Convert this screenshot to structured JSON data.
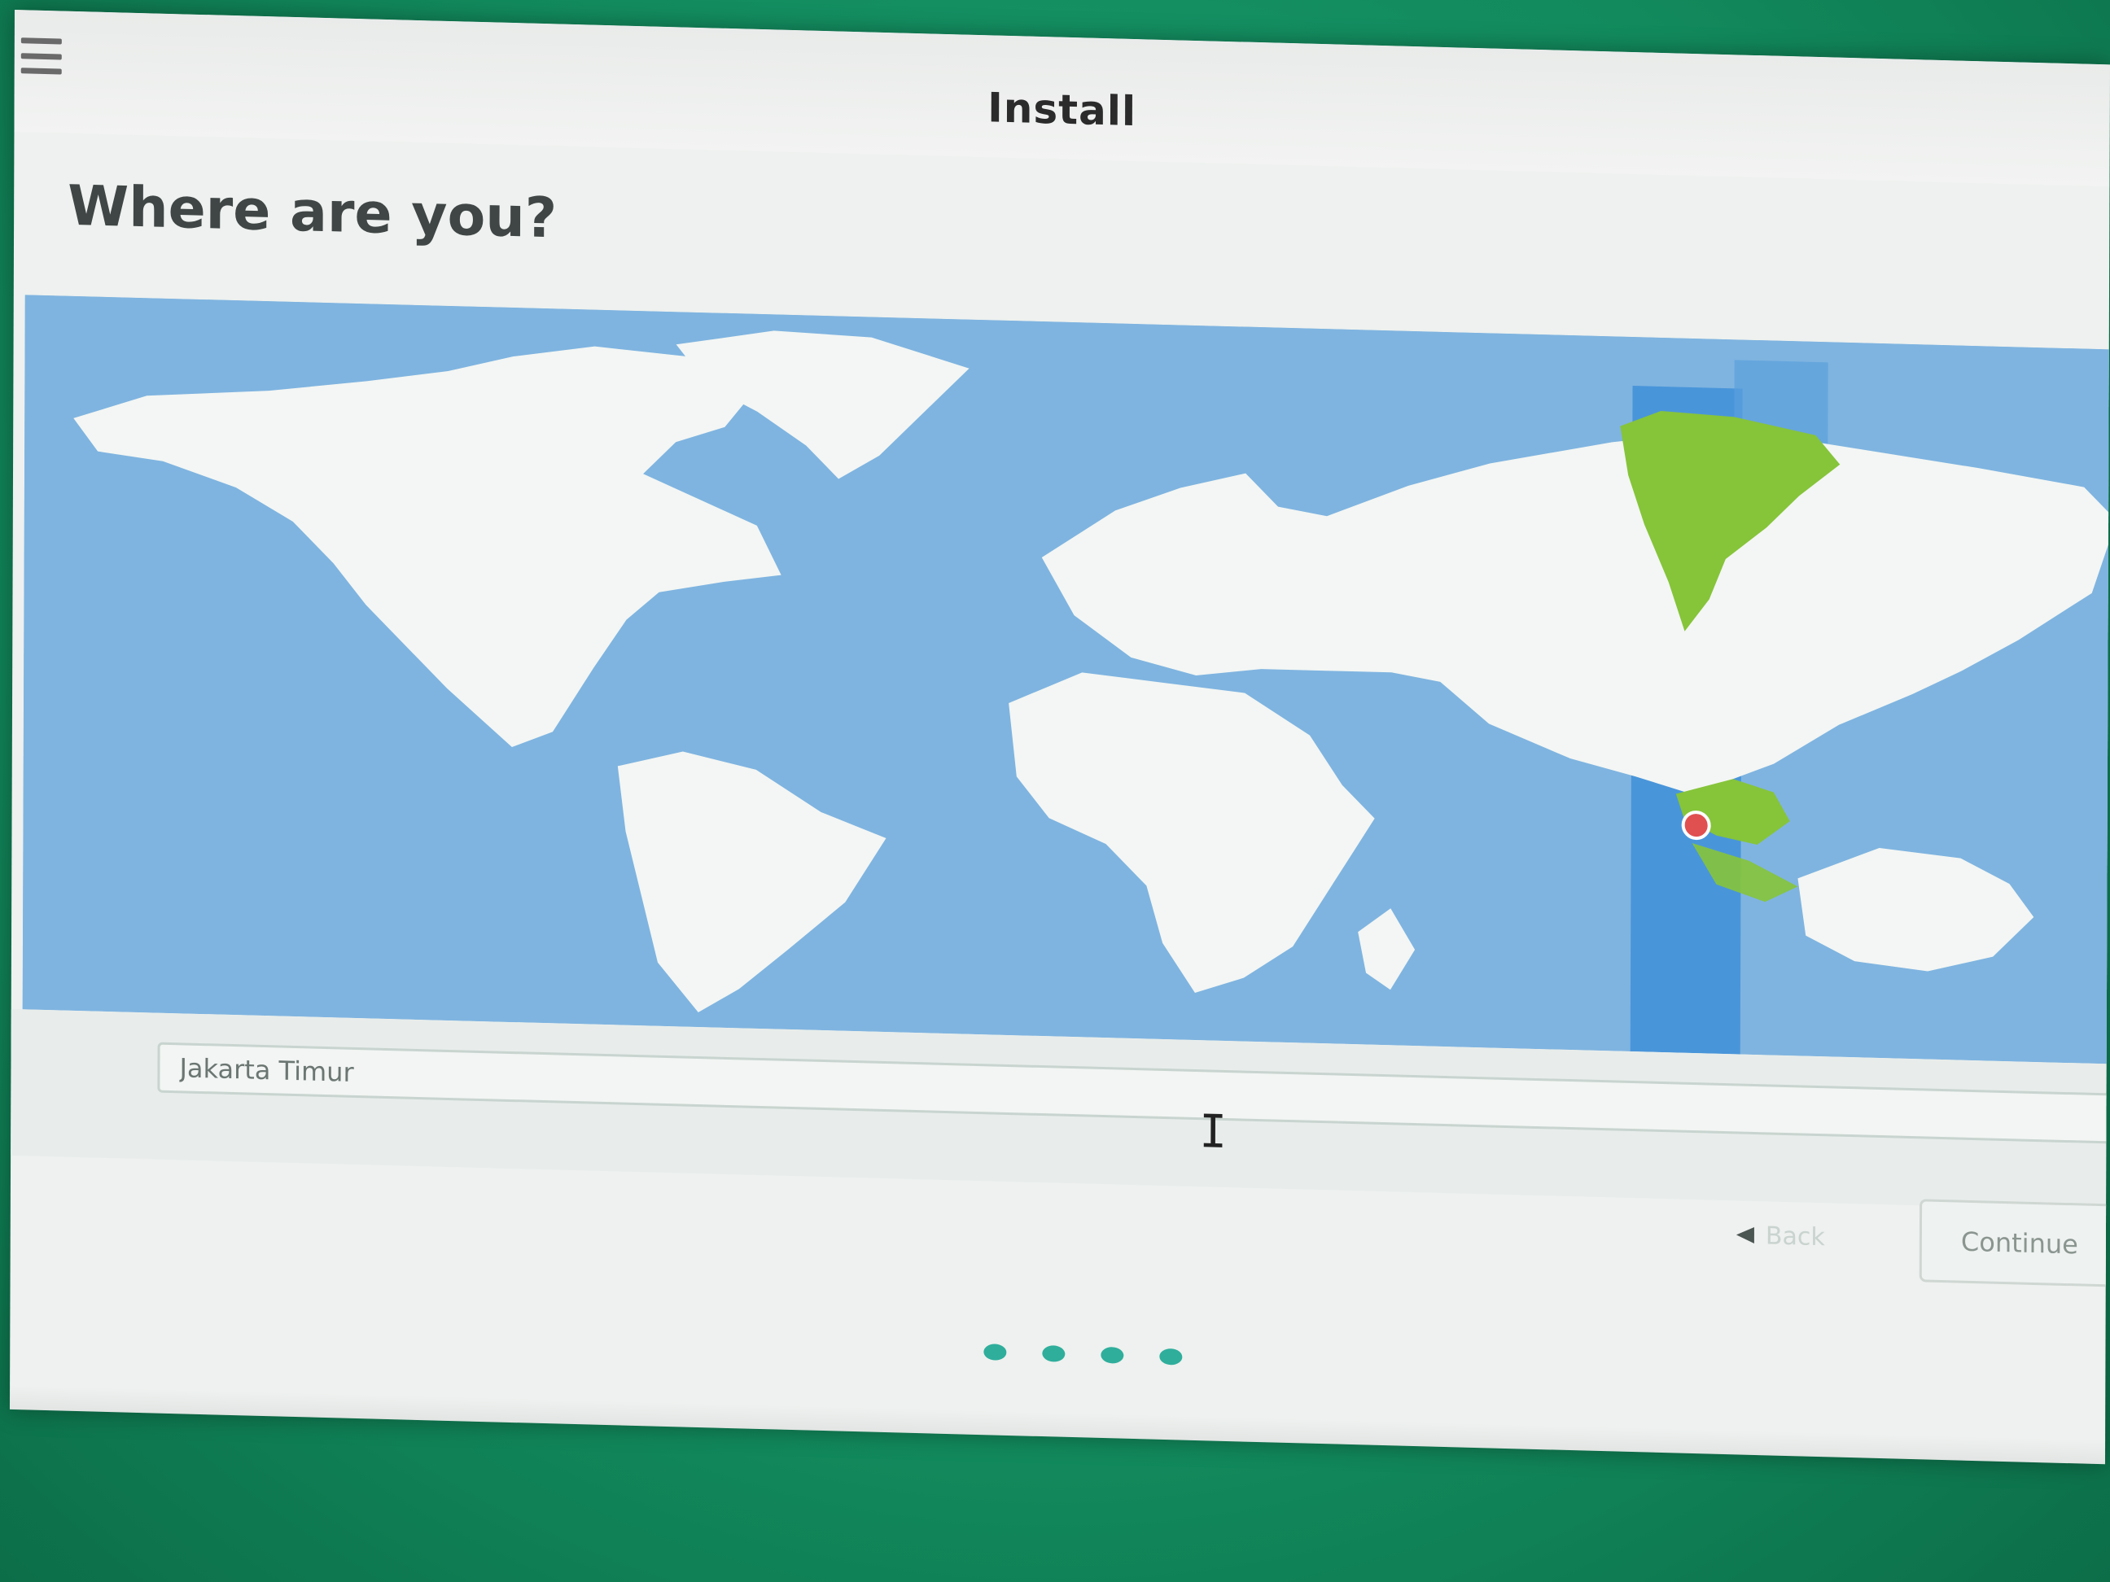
{
  "window": {
    "title": "Install"
  },
  "page": {
    "heading": "Where are you?"
  },
  "map": {
    "selected_timezone_highlight": "#3f8fd8",
    "selected_region_color": "#86c43a",
    "marker_color": "#e05050",
    "ocean_color": "#7fb4e0",
    "land_color": "#f3f6f4"
  },
  "location": {
    "value": "Jakarta Timur"
  },
  "navigation": {
    "back_label": "Back",
    "continue_label": "Continue"
  },
  "progress": {
    "total_steps": 4
  },
  "icons": {
    "menu": "hamburger-menu-icon",
    "text_cursor": "i-beam-cursor-icon",
    "back": "left-arrow-icon",
    "marker": "location-pin-icon"
  }
}
